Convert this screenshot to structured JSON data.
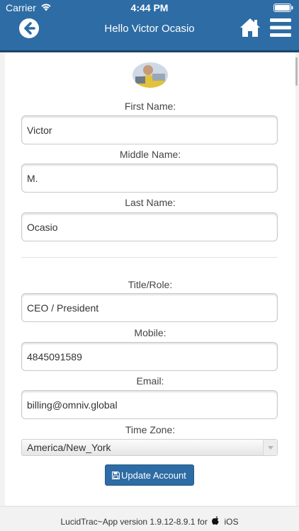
{
  "status_bar": {
    "carrier": "Carrier",
    "time": "4:44 PM"
  },
  "nav": {
    "title": "Hello Victor Ocasio",
    "back_icon": "arrow-left-circle-icon",
    "home_icon": "home-icon",
    "menu_icon": "hamburger-menu-icon"
  },
  "form": {
    "first_name": {
      "label": "First Name:",
      "value": "Victor"
    },
    "middle_name": {
      "label": "Middle Name:",
      "value": "M."
    },
    "last_name": {
      "label": "Last Name:",
      "value": "Ocasio"
    },
    "title_role": {
      "label": "Title/Role:",
      "value": "CEO / President"
    },
    "mobile": {
      "label": "Mobile:",
      "value": "4845091589"
    },
    "email": {
      "label": "Email:",
      "value": "billing@omniv.global"
    },
    "time_zone": {
      "label": "Time Zone:",
      "value": "America/New_York"
    },
    "update_button": "Update Account"
  },
  "footer": {
    "version_text": "LucidTrac~App version 1.9.12-8.9.1 for",
    "platform": "iOS"
  },
  "colors": {
    "header": "#2d6ca4",
    "button": "#2d6ca4",
    "page_bg": "#f2f2f2"
  }
}
